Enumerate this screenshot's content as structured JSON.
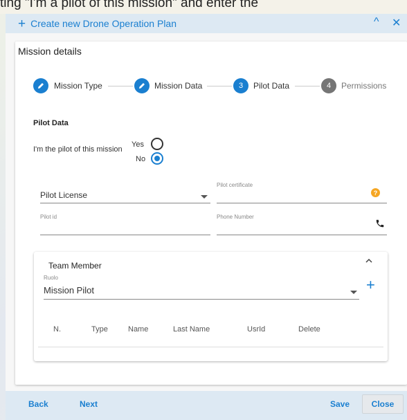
{
  "background_text": "ting \"I'm a pilot of this mission\" and enter the",
  "dialog": {
    "title": "Create new Drone Operation Plan",
    "collapse_symbol": "^",
    "close_symbol": "✕"
  },
  "card": {
    "title": "Mission details"
  },
  "stepper": {
    "steps": [
      {
        "number": "✎",
        "label": "Mission Type",
        "state": "done"
      },
      {
        "number": "✎",
        "label": "Mission Data",
        "state": "done"
      },
      {
        "number": "3",
        "label": "Pilot Data",
        "state": "active"
      },
      {
        "number": "4",
        "label": "Permissions",
        "state": "inactive"
      }
    ]
  },
  "pilot": {
    "section_title": "Pilot Data",
    "question": "I'm the pilot of this mission",
    "yes_label": "Yes",
    "no_label": "No",
    "selected": "No"
  },
  "fields": {
    "license_value": "Pilot License",
    "certificate_label": "Pilot certificate",
    "pilot_id_label": "Pilot id",
    "phone_label": "Phone Number",
    "help_symbol": "?"
  },
  "team": {
    "title": "Team Member",
    "role_label": "Ruolo",
    "role_value": "Mission Pilot",
    "add_symbol": "+",
    "columns": [
      "N.",
      "Type",
      "Name",
      "Last Name",
      "UsrId",
      "Delete"
    ]
  },
  "footer": {
    "back_label": "Back",
    "next_label": "Next",
    "save_label": "Save",
    "close_label": "Close"
  },
  "colors": {
    "accent": "#1a7fd0",
    "help": "#f5a623",
    "inactive": "#757575"
  }
}
